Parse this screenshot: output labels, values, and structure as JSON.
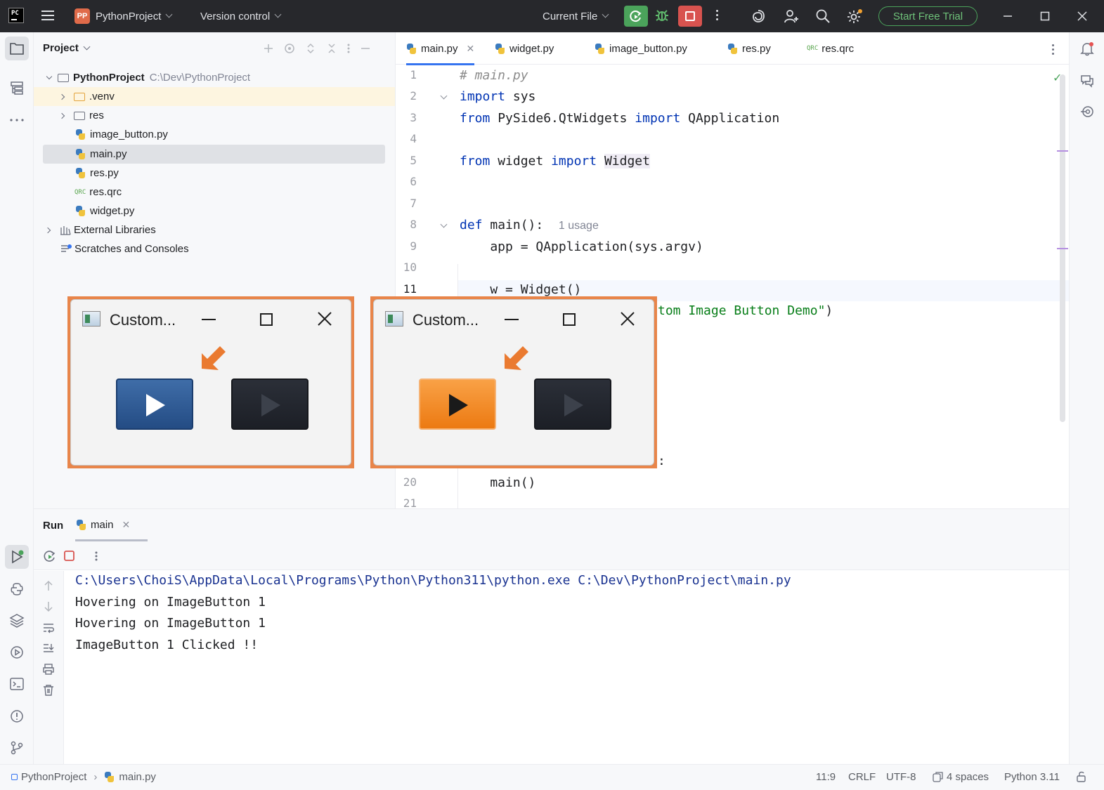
{
  "titlebar": {
    "project_badge": "PP",
    "project_name": "PythonProject",
    "version_control": "Version control",
    "run_config": "Current File",
    "trial_button": "Start Free Trial"
  },
  "project_panel": {
    "title": "Project",
    "root_name": "PythonProject",
    "root_path": "C:\\Dev\\PythonProject",
    "items": [
      {
        "label": ".venv"
      },
      {
        "label": "res"
      },
      {
        "label": "image_button.py"
      },
      {
        "label": "main.py"
      },
      {
        "label": "res.py"
      },
      {
        "label": "res.qrc"
      },
      {
        "label": "widget.py"
      },
      {
        "label": "External Libraries"
      },
      {
        "label": "Scratches and Consoles"
      }
    ],
    "qrc_icon_text": "QRC"
  },
  "editor": {
    "tabs": [
      {
        "label": "main.py"
      },
      {
        "label": "widget.py"
      },
      {
        "label": "image_button.py"
      },
      {
        "label": "res.py"
      },
      {
        "label": "res.qrc"
      }
    ],
    "line_numbers": [
      "1",
      "2",
      "3",
      "4",
      "5",
      "6",
      "7",
      "8",
      "9",
      "10",
      "11",
      "20",
      "21"
    ],
    "code": {
      "l1": "# main.py",
      "l2_kw": "import",
      "l2_rest": " sys",
      "l3_kw1": "from",
      "l3_mid": " PySide6.QtWidgets ",
      "l3_kw2": "import",
      "l3_rest": " QApplication",
      "l5_kw1": "from",
      "l5_mid": " widget ",
      "l5_kw2": "import",
      "l5_hl": "Widget",
      "l8_kw": "def",
      "l8_rest": " main():",
      "l8_hint": "1 usage",
      "l9": "    app = QApplication(sys.argv)",
      "l11": "    w = Widget()",
      "l12_str": "tom Image Button Demo\"",
      "l12_rest": ")",
      "l19_rest": ":",
      "l20": "    main()"
    }
  },
  "run_panel": {
    "title": "Run",
    "tab_label": "main",
    "output": [
      "C:\\Users\\ChoiS\\AppData\\Local\\Programs\\Python\\Python311\\python.exe C:\\Dev\\PythonProject\\main.py",
      "Hovering on ImageButton 1",
      "Hovering on ImageButton 1",
      "ImageButton 1 Clicked !!"
    ]
  },
  "statusbar": {
    "breadcrumb_project": "PythonProject",
    "breadcrumb_file": "main.py",
    "position": "11:9",
    "line_ending": "CRLF",
    "encoding": "UTF-8",
    "indent": "4 spaces",
    "interpreter": "Python 3.11"
  },
  "demo_windows": [
    {
      "title": "Custom...",
      "state": "normal"
    },
    {
      "title": "Custom...",
      "state": "hovered"
    }
  ],
  "colors": {
    "accent": "#3574f0",
    "run_green": "#4ba35b",
    "stop_red": "#d8534f",
    "highlight_orange": "#e8854a",
    "keyword": "#0033b3",
    "string": "#067d17"
  }
}
